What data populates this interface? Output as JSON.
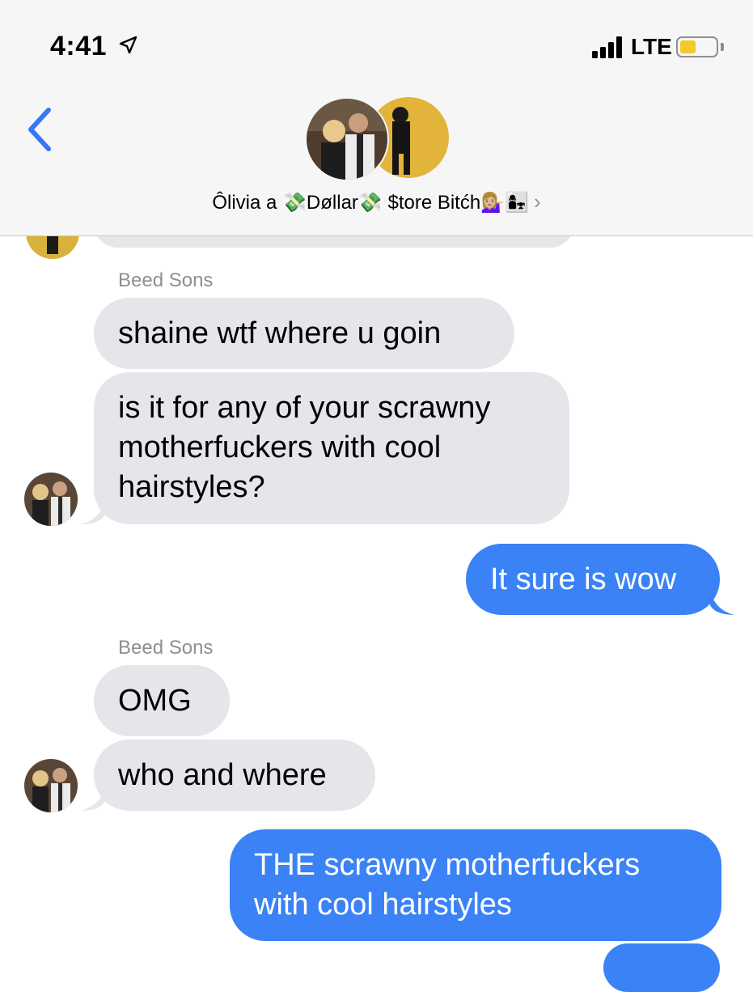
{
  "status_bar": {
    "time": "4:41",
    "network": "LTE",
    "battery_level": 0.45,
    "battery_color": "#f4c92c"
  },
  "header": {
    "group_name": "Ôlivia a 💸Døllar💸 $tore Bitćh💁🏼‍♀️👩‍👧",
    "chevron": "›",
    "back_icon": "chevron-left-icon"
  },
  "colors": {
    "incoming_bubble": "#e5e5ea",
    "outgoing_bubble": "#3a82f6",
    "accent": "#3478f6"
  },
  "messages": [
    {
      "sender": "Beed Sons",
      "text": "shaine wtf where u goin",
      "direction": "incoming"
    },
    {
      "text": "is it for any of your scrawny motherfuckers with cool hairstyles?",
      "direction": "incoming"
    },
    {
      "text": "It sure is wow",
      "direction": "outgoing"
    },
    {
      "sender": "Beed Sons",
      "text": "OMG",
      "direction": "incoming"
    },
    {
      "text": "who and where",
      "direction": "incoming"
    },
    {
      "text": "THE scrawny motherfuckers with cool hairstyles",
      "direction": "outgoing"
    }
  ],
  "message_lines": {
    "m2": [
      "is it for any of your scrawny",
      "motherfuckers with cool",
      "hairstyles?"
    ],
    "m6": [
      "THE scrawny motherfuckers",
      "with cool hairstyles"
    ]
  }
}
